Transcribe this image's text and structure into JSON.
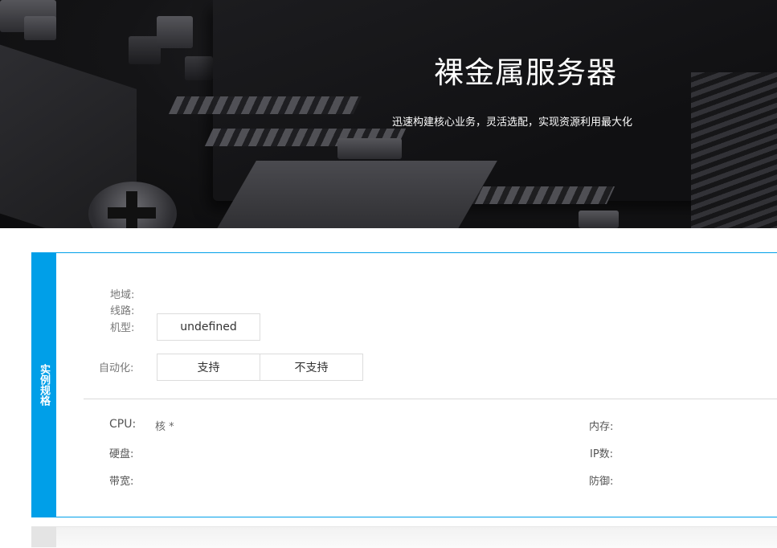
{
  "hero": {
    "title": "裸金属服务器",
    "subtitle": "迅速构建核心业务，灵活选配，实现资源利用最大化"
  },
  "spec_panel": {
    "tab_label": "实例规格",
    "accent_color": "#009fe8",
    "region_label": "地域:",
    "line_label": "线路:",
    "model_label": "机型:",
    "model_option": "undefined",
    "automation_label": "自动化:",
    "automation_options": [
      "支持",
      "不支持"
    ],
    "cpu_label": "CPU:",
    "cpu_value": "核 *",
    "memory_label": "内存:",
    "disk_label": "硬盘:",
    "ip_label": "IP数:",
    "bandwidth_label": "带宽:",
    "ddos_label": "防御:"
  }
}
